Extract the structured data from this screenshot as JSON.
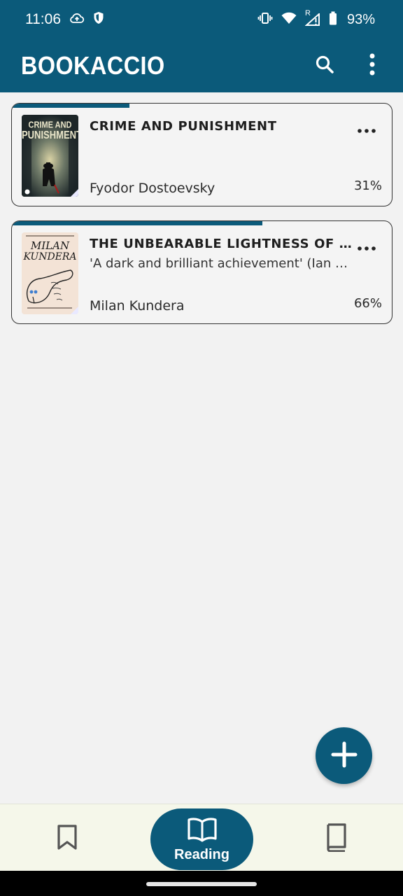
{
  "status_bar": {
    "time": "11:06",
    "battery_percent": "93%",
    "network_label": "R"
  },
  "app_bar": {
    "title": "BOOKACCIO",
    "search_icon": "search-icon",
    "menu_icon": "more-vert-icon"
  },
  "books": [
    {
      "title": "CRIME AND PUNISHMENT",
      "subtitle": "",
      "author": "Fyodor Dostoevsky",
      "percent": "31%",
      "progress": 0.31,
      "cover_text_line1": "CRIME AND",
      "cover_text_line2": "PUNISHMENT"
    },
    {
      "title": "THE UNBEARABLE LIGHTNESS OF BEING",
      "subtitle": "'A dark and brilliant achievement' (Ian McEwan)",
      "author": "Milan Kundera",
      "percent": "66%",
      "progress": 0.66,
      "cover_text_line1": "MILAN",
      "cover_text_line2": "KUNDERA"
    }
  ],
  "fab": {
    "icon": "plus-icon"
  },
  "bottom_nav": {
    "items": [
      {
        "icon": "bookmark-icon",
        "label": ""
      },
      {
        "icon": "open-book-icon",
        "label": "Reading"
      },
      {
        "icon": "book-icon",
        "label": ""
      }
    ]
  },
  "colors": {
    "primary": "#0b5a7a",
    "background": "#f2f2f2",
    "nav_background": "#f5f7ea"
  }
}
